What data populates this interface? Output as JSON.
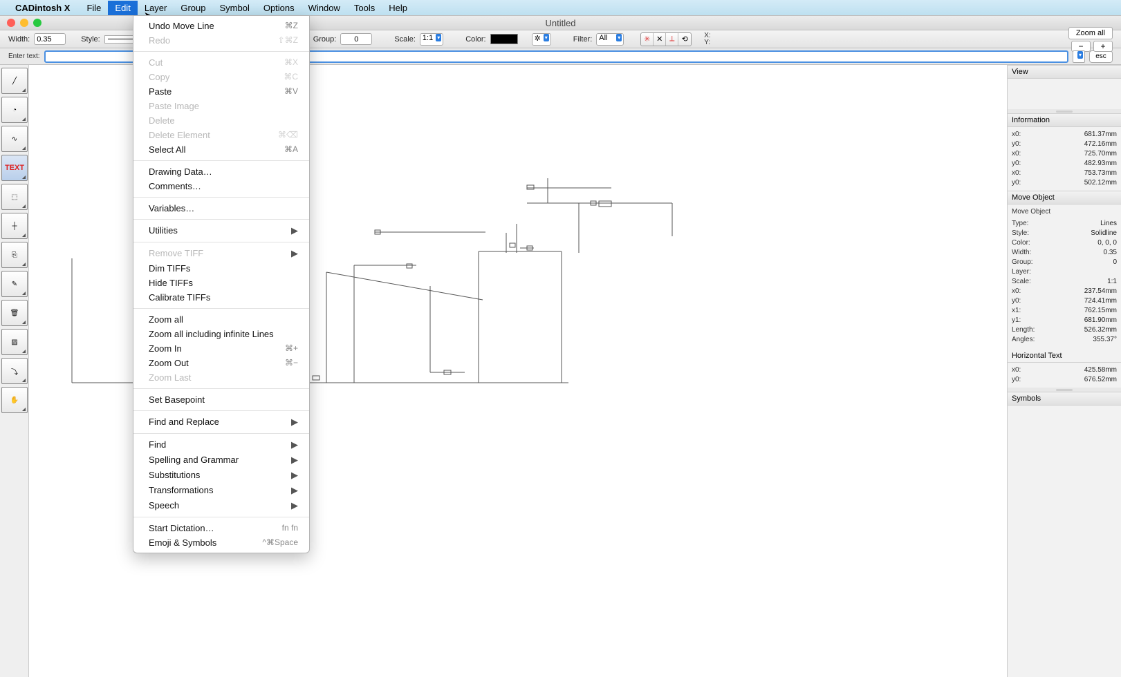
{
  "menubar": {
    "appname": "CADintosh X",
    "items": [
      "File",
      "Edit",
      "Layer",
      "Group",
      "Symbol",
      "Options",
      "Window",
      "Tools",
      "Help"
    ],
    "active_index": 1
  },
  "window": {
    "title": "Untitled"
  },
  "toolbar": {
    "width_label": "Width:",
    "width_value": "0.35",
    "style_label": "Style:",
    "group_label": "Group:",
    "group_value": "0",
    "scale_label": "Scale:",
    "scale_value": "1:1",
    "color_label": "Color:",
    "filter_label": "Filter:",
    "filter_value": "All",
    "coord_x": "X:",
    "coord_y": "Y:",
    "gear": "✲",
    "snap_icons": [
      "✳",
      "✕",
      "⟂",
      "⟲"
    ],
    "zoom_all": "Zoom all",
    "minus": "−",
    "plus": "+",
    "esc": "esc"
  },
  "entry": {
    "label": "Enter text:"
  },
  "tools": [
    {
      "name": "line-tool",
      "glyph": "╱",
      "sel": false
    },
    {
      "name": "arc-tool",
      "glyph": "◔",
      "sel": false
    },
    {
      "name": "curve-tool",
      "glyph": "∿",
      "sel": false
    },
    {
      "name": "text-tool",
      "glyph": "TEXT",
      "sel": true,
      "text": true
    },
    {
      "name": "dim-x-tool",
      "glyph": "⬚",
      "sel": false
    },
    {
      "name": "coord-tool",
      "glyph": "┼",
      "sel": false
    },
    {
      "name": "copy-tool",
      "glyph": "⎘",
      "sel": false
    },
    {
      "name": "bezier-tool",
      "glyph": "✎",
      "sel": false
    },
    {
      "name": "trash-tool",
      "glyph": "🗑",
      "sel": false
    },
    {
      "name": "hatch-tool",
      "glyph": "▨",
      "sel": false
    },
    {
      "name": "path-tool",
      "glyph": "⤵",
      "sel": false
    },
    {
      "name": "hand-tool",
      "glyph": "✋",
      "sel": false
    }
  ],
  "right": {
    "view_title": "View",
    "info_title": "Information",
    "info_rows": [
      [
        "x0:",
        "681.37mm"
      ],
      [
        "y0:",
        "472.16mm"
      ],
      [
        "x0:",
        "725.70mm"
      ],
      [
        "y0:",
        "482.93mm"
      ],
      [
        "x0:",
        "753.73mm"
      ],
      [
        "y0:",
        "502.12mm"
      ]
    ],
    "move_title": "Move Object",
    "move_obj_section": "Move Object",
    "move_rows": [
      [
        "Type:",
        "Lines"
      ],
      [
        "Style:",
        "Solidline"
      ],
      [
        "Color:",
        "0, 0, 0"
      ],
      [
        "Width:",
        "0.35"
      ],
      [
        "Group:",
        "0"
      ],
      [
        "Layer:",
        ""
      ],
      [
        "Scale:",
        "1:1"
      ],
      [
        "x0:",
        "237.54mm"
      ],
      [
        "y0:",
        "724.41mm"
      ],
      [
        "x1:",
        "762.15mm"
      ],
      [
        "y1:",
        "681.90mm"
      ],
      [
        "Length:",
        "526.32mm"
      ],
      [
        "Angles:",
        "355.37°"
      ]
    ],
    "htext_title": "Horizontal Text",
    "htext_rows": [
      [
        "x0:",
        "425.58mm"
      ],
      [
        "y0:",
        "676.52mm"
      ]
    ],
    "symbols_title": "Symbols"
  },
  "menu": {
    "sections": [
      [
        {
          "label": "Undo Move Line",
          "sc": "⌘Z"
        },
        {
          "label": "Redo",
          "sc": "⇧⌘Z",
          "disabled": true
        }
      ],
      [
        {
          "label": "Cut",
          "sc": "⌘X",
          "disabled": true
        },
        {
          "label": "Copy",
          "sc": "⌘C",
          "disabled": true
        },
        {
          "label": "Paste",
          "sc": "⌘V"
        },
        {
          "label": "Paste Image",
          "disabled": true
        },
        {
          "label": "Delete",
          "disabled": true
        },
        {
          "label": "Delete Element",
          "sc": "⌘⌫",
          "disabled": true
        },
        {
          "label": "Select All",
          "sc": "⌘A"
        }
      ],
      [
        {
          "label": "Drawing Data…"
        },
        {
          "label": "Comments…"
        }
      ],
      [
        {
          "label": "Variables…"
        }
      ],
      [
        {
          "label": "Utilities",
          "sub": true
        }
      ],
      [
        {
          "label": "Remove TIFF",
          "sub": true,
          "disabled": true
        },
        {
          "label": "Dim TIFFs"
        },
        {
          "label": "Hide TIFFs"
        },
        {
          "label": "Calibrate TIFFs"
        }
      ],
      [
        {
          "label": "Zoom all"
        },
        {
          "label": "Zoom all including infinite Lines"
        },
        {
          "label": "Zoom In",
          "sc": "⌘+"
        },
        {
          "label": "Zoom Out",
          "sc": "⌘−"
        },
        {
          "label": "Zoom Last",
          "disabled": true
        }
      ],
      [
        {
          "label": "Set Basepoint"
        }
      ],
      [
        {
          "label": "Find and Replace",
          "sub": true
        }
      ],
      [
        {
          "label": "Find",
          "sub": true
        },
        {
          "label": "Spelling and Grammar",
          "sub": true
        },
        {
          "label": "Substitutions",
          "sub": true
        },
        {
          "label": "Transformations",
          "sub": true
        },
        {
          "label": "Speech",
          "sub": true
        }
      ],
      [
        {
          "label": "Start Dictation…",
          "sc": "fn fn"
        },
        {
          "label": "Emoji & Symbols",
          "sc": "^⌘Space"
        }
      ]
    ]
  }
}
